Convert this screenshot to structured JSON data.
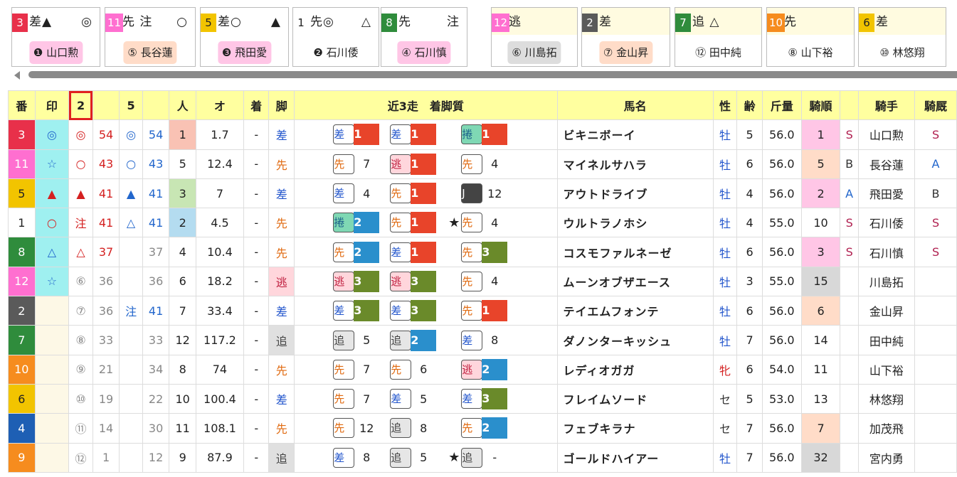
{
  "cards": [
    {
      "num": "3",
      "num_bg": "#e8304a",
      "style": "差▲",
      "mark_r": "◎",
      "jockey": "❶ 山口勲",
      "jockey_bg": "#ffc6e6"
    },
    {
      "num": "11",
      "num_bg": "#ff6fd0",
      "style": "先 注",
      "mark_r": "○",
      "jockey": "⑤ 長谷蓮",
      "jockey_bg": "#ffdcc8"
    },
    {
      "num": "5",
      "num_bg": "#f2c400",
      "style": "差○",
      "mark_r": "▲",
      "jockey": "❸ 飛田愛",
      "jockey_bg": "#ffc6e6"
    },
    {
      "num": "1",
      "num_bg": "#ffffff",
      "style": "先◎",
      "mark_r": "△",
      "jockey": "❷ 石川倭",
      "jockey_bg": "#ffffff"
    },
    {
      "num": "8",
      "num_bg": "#2f8c3c",
      "style": "先",
      "mark_r": "注",
      "jockey": "④ 石川慎",
      "jockey_bg": "#ffc6e6"
    },
    {
      "num": "12",
      "num_bg": "#ff6fd0",
      "style": "逃",
      "mark_r": "",
      "jockey": "⑥ 川島拓",
      "jockey_bg": "#dddddd"
    },
    {
      "num": "2",
      "num_bg": "#5a5a5a",
      "style": "差",
      "mark_r": "",
      "jockey": "⑦ 金山昇",
      "jockey_bg": "#ffdcc8"
    },
    {
      "num": "7",
      "num_bg": "#2f8c3c",
      "style": "追 △",
      "mark_r": "",
      "jockey": "⑫ 田中純",
      "jockey_bg": "#ffffff"
    },
    {
      "num": "10",
      "num_bg": "#f68c1e",
      "style": "先",
      "mark_r": "",
      "jockey": "⑧ 山下裕",
      "jockey_bg": "#ffffff"
    },
    {
      "num": "6",
      "num_bg": "#f2c400",
      "style": "差",
      "mark_r": "",
      "jockey": "⑩ 林悠翔",
      "jockey_bg": "#ffffff"
    }
  ],
  "headers": {
    "ban": "番",
    "shirushi": "印",
    "c2": "2",
    "c5": "5",
    "ninki": "人",
    "odds": "オ",
    "chaku": "着",
    "kyaku": "脚",
    "kinsou": "近3走　着脚質",
    "name": "馬名",
    "sex": "性",
    "age": "齢",
    "weight": "斤量",
    "kijun": "騎順",
    "jockey": "騎手",
    "kihi": "騎厩"
  },
  "colors": {
    "sa": "#2255cc",
    "sen": "#e06a10",
    "nige": "#c02040",
    "oi": "#444444",
    "makuri": "#1a5f8a",
    "r1": "#e8442a",
    "r2": "#2a8fcc",
    "r3": "#6a8a2a",
    "rJ": "#444444"
  },
  "rows": [
    {
      "num": "3",
      "num_bg": "#e8304a",
      "mark": "◎",
      "mark_bg": "#9ff0f0",
      "m2": "◎",
      "m2c": "#d42020",
      "s2": "54",
      "m5": "◎",
      "m5c": "#2266cc",
      "s5": "54",
      "ninki": "1",
      "ninki_bg": "#f9c2b4",
      "odds": "1.7",
      "chaku": "-",
      "kyaku": "差",
      "kyaku_bg": "",
      "kinsou": [
        {
          "t": "差",
          "r": "1"
        },
        {
          "t": "差",
          "r": "1"
        },
        {
          "t": "捲",
          "r": "1"
        }
      ],
      "star": "",
      "name": "ビキニボーイ",
      "sex": "牡",
      "sexc": "#2255cc",
      "age": "5",
      "weight": "56.0",
      "kijun": "1",
      "kijun_bg": "#ffc6e6",
      "rank": "S",
      "rankc": "#b02050",
      "jockey": "山口勲",
      "kihi": "S",
      "kihic": "#b02050"
    },
    {
      "num": "11",
      "num_bg": "#ff6fd0",
      "mark": "☆",
      "mark_bg": "#9ff0f0",
      "m2": "○",
      "m2c": "#d42020",
      "s2": "43",
      "m5": "○",
      "m5c": "#2266cc",
      "s5": "43",
      "ninki": "5",
      "ninki_bg": "",
      "odds": "12.4",
      "chaku": "-",
      "kyaku": "先",
      "kyaku_bg": "",
      "kinsou": [
        {
          "t": "先",
          "r": "7"
        },
        {
          "t": "逃",
          "r": "1"
        },
        {
          "t": "先",
          "r": "4"
        }
      ],
      "star": "",
      "name": "マイネルサハラ",
      "sex": "牡",
      "sexc": "#2255cc",
      "age": "6",
      "weight": "56.0",
      "kijun": "5",
      "kijun_bg": "#ffdcc8",
      "rank": "B",
      "rankc": "#333333",
      "jockey": "長谷蓮",
      "kihi": "A",
      "kihic": "#2266cc"
    },
    {
      "num": "5",
      "num_bg": "#f2c400",
      "mark": "▲",
      "mark_bg": "#9ff0f0",
      "m2": "▲",
      "m2c": "#d42020",
      "s2": "41",
      "m5": "▲",
      "m5c": "#2266cc",
      "s5": "41",
      "ninki": "3",
      "ninki_bg": "#c8e6b4",
      "odds": "7",
      "chaku": "-",
      "kyaku": "差",
      "kyaku_bg": "",
      "kinsou": [
        {
          "t": "差",
          "r": "4"
        },
        {
          "t": "先",
          "r": "1"
        },
        {
          "t": "J",
          "r": "12"
        }
      ],
      "star": "",
      "name": "アウトドライブ",
      "sex": "牡",
      "sexc": "#2255cc",
      "age": "4",
      "weight": "56.0",
      "kijun": "2",
      "kijun_bg": "#ffc6e6",
      "rank": "A",
      "rankc": "#2266cc",
      "jockey": "飛田愛",
      "kihi": "B",
      "kihic": "#333333"
    },
    {
      "num": "1",
      "num_bg": "#ffffff",
      "mark": "○",
      "mark_bg": "#9ff0f0",
      "m2": "注",
      "m2c": "#d42020",
      "s2": "41",
      "m5": "△",
      "m5c": "#2266cc",
      "s5": "41",
      "ninki": "2",
      "ninki_bg": "#b4dcf0",
      "odds": "4.5",
      "chaku": "-",
      "kyaku": "先",
      "kyaku_bg": "",
      "kinsou": [
        {
          "t": "捲",
          "r": "2"
        },
        {
          "t": "先",
          "r": "1"
        },
        {
          "t": "先",
          "r": "4"
        }
      ],
      "star": "★",
      "name": "ウルトラノホシ",
      "sex": "牡",
      "sexc": "#2255cc",
      "age": "4",
      "weight": "55.0",
      "kijun": "10",
      "kijun_bg": "",
      "rank": "S",
      "rankc": "#b02050",
      "jockey": "石川倭",
      "kihi": "S",
      "kihic": "#b02050"
    },
    {
      "num": "8",
      "num_bg": "#2f8c3c",
      "mark": "△",
      "mark_bg": "#9ff0f0",
      "m2": "△",
      "m2c": "#d42020",
      "s2": "37",
      "m5": "",
      "m5c": "#2266cc",
      "s5": "37",
      "ninki": "4",
      "ninki_bg": "",
      "odds": "10.4",
      "chaku": "-",
      "kyaku": "先",
      "kyaku_bg": "",
      "kinsou": [
        {
          "t": "先",
          "r": "2"
        },
        {
          "t": "差",
          "r": "1"
        },
        {
          "t": "先",
          "r": "3"
        }
      ],
      "star": "",
      "name": "コスモファルネーゼ",
      "sex": "牡",
      "sexc": "#2255cc",
      "age": "6",
      "weight": "56.0",
      "kijun": "3",
      "kijun_bg": "#ffc6e6",
      "rank": "S",
      "rankc": "#b02050",
      "jockey": "石川慎",
      "kihi": "S",
      "kihic": "#b02050"
    },
    {
      "num": "12",
      "num_bg": "#ff6fd0",
      "mark": "☆",
      "mark_bg": "#9ff0f0",
      "m2": "⑥",
      "m2c": "#888888",
      "s2": "36",
      "m5": "",
      "m5c": "#2266cc",
      "s5": "36",
      "ninki": "6",
      "ninki_bg": "",
      "odds": "18.2",
      "chaku": "-",
      "kyaku": "逃",
      "kyaku_bg": "#ffd6dc",
      "kinsou": [
        {
          "t": "逃",
          "r": "3"
        },
        {
          "t": "逃",
          "r": "3"
        },
        {
          "t": "先",
          "r": "4"
        }
      ],
      "star": "",
      "name": "ムーンオブザエース",
      "sex": "牡",
      "sexc": "#2255cc",
      "age": "3",
      "weight": "55.0",
      "kijun": "15",
      "kijun_bg": "#d8d8d8",
      "rank": "",
      "rankc": "#333333",
      "jockey": "川島拓",
      "kihi": "",
      "kihic": "#333333"
    },
    {
      "num": "2",
      "num_bg": "#5a5a5a",
      "mark": "",
      "mark_bg": "#fdf8e6",
      "m2": "⑦",
      "m2c": "#888888",
      "s2": "36",
      "m5": "注",
      "m5c": "#2266cc",
      "s5": "41",
      "ninki": "7",
      "ninki_bg": "",
      "odds": "33.4",
      "chaku": "-",
      "kyaku": "差",
      "kyaku_bg": "",
      "kinsou": [
        {
          "t": "差",
          "r": "3"
        },
        {
          "t": "差",
          "r": "3"
        },
        {
          "t": "先",
          "r": "1"
        }
      ],
      "star": "",
      "name": "テイエムフォンテ",
      "sex": "牡",
      "sexc": "#2255cc",
      "age": "6",
      "weight": "56.0",
      "kijun": "6",
      "kijun_bg": "#ffdcc8",
      "rank": "",
      "rankc": "#333333",
      "jockey": "金山昇",
      "kihi": "",
      "kihic": "#333333"
    },
    {
      "num": "7",
      "num_bg": "#2f8c3c",
      "mark": "",
      "mark_bg": "#fdf8e6",
      "m2": "⑧",
      "m2c": "#888888",
      "s2": "33",
      "m5": "",
      "m5c": "#2266cc",
      "s5": "33",
      "ninki": "12",
      "ninki_bg": "",
      "odds": "117.2",
      "chaku": "-",
      "kyaku": "追",
      "kyaku_bg": "#e0e0e0",
      "kinsou": [
        {
          "t": "追",
          "r": "5"
        },
        {
          "t": "追",
          "r": "2"
        },
        {
          "t": "差",
          "r": "8"
        }
      ],
      "star": "",
      "name": "ダノンターキッシュ",
      "sex": "牡",
      "sexc": "#2255cc",
      "age": "7",
      "weight": "56.0",
      "kijun": "14",
      "kijun_bg": "",
      "rank": "",
      "rankc": "#333333",
      "jockey": "田中純",
      "kihi": "",
      "kihic": "#333333"
    },
    {
      "num": "10",
      "num_bg": "#f68c1e",
      "mark": "",
      "mark_bg": "#fdf8e6",
      "m2": "⑨",
      "m2c": "#888888",
      "s2": "21",
      "m5": "",
      "m5c": "#2266cc",
      "s5": "34",
      "ninki": "8",
      "ninki_bg": "",
      "odds": "74",
      "chaku": "-",
      "kyaku": "先",
      "kyaku_bg": "",
      "kinsou": [
        {
          "t": "先",
          "r": "7"
        },
        {
          "t": "先",
          "r": "6"
        },
        {
          "t": "逃",
          "r": "2"
        }
      ],
      "star": "",
      "name": "レディオガガ",
      "sex": "牝",
      "sexc": "#d42020",
      "age": "6",
      "weight": "54.0",
      "kijun": "11",
      "kijun_bg": "",
      "rank": "",
      "rankc": "#333333",
      "jockey": "山下裕",
      "kihi": "",
      "kihic": "#333333"
    },
    {
      "num": "6",
      "num_bg": "#f2c400",
      "mark": "",
      "mark_bg": "#fdf8e6",
      "m2": "⑩",
      "m2c": "#888888",
      "s2": "19",
      "m5": "",
      "m5c": "#2266cc",
      "s5": "22",
      "ninki": "10",
      "ninki_bg": "",
      "odds": "100.4",
      "chaku": "-",
      "kyaku": "差",
      "kyaku_bg": "",
      "kinsou": [
        {
          "t": "先",
          "r": "7"
        },
        {
          "t": "差",
          "r": "5"
        },
        {
          "t": "差",
          "r": "3"
        }
      ],
      "star": "",
      "name": "フレイムソード",
      "sex": "セ",
      "sexc": "#333333",
      "age": "5",
      "weight": "53.0",
      "kijun": "13",
      "kijun_bg": "",
      "rank": "",
      "rankc": "#333333",
      "jockey": "林悠翔",
      "kihi": "",
      "kihic": "#333333"
    },
    {
      "num": "4",
      "num_bg": "#1e5fb4",
      "mark": "",
      "mark_bg": "#fdf8e6",
      "m2": "⑪",
      "m2c": "#888888",
      "s2": "14",
      "m5": "",
      "m5c": "#2266cc",
      "s5": "30",
      "ninki": "11",
      "ninki_bg": "",
      "odds": "108.1",
      "chaku": "-",
      "kyaku": "先",
      "kyaku_bg": "",
      "kinsou": [
        {
          "t": "先",
          "r": "12"
        },
        {
          "t": "追",
          "r": "8"
        },
        {
          "t": "先",
          "r": "2"
        }
      ],
      "star": "",
      "name": "フェブキラナ",
      "sex": "セ",
      "sexc": "#333333",
      "age": "7",
      "weight": "56.0",
      "kijun": "7",
      "kijun_bg": "#ffdcc8",
      "rank": "",
      "rankc": "#333333",
      "jockey": "加茂飛",
      "kihi": "",
      "kihic": "#333333"
    },
    {
      "num": "9",
      "num_bg": "#f68c1e",
      "mark": "",
      "mark_bg": "#fdf8e6",
      "m2": "⑫",
      "m2c": "#888888",
      "s2": "1",
      "m5": "",
      "m5c": "#2266cc",
      "s5": "12",
      "ninki": "9",
      "ninki_bg": "",
      "odds": "87.9",
      "chaku": "-",
      "kyaku": "追",
      "kyaku_bg": "#e0e0e0",
      "kinsou": [
        {
          "t": "差",
          "r": "8"
        },
        {
          "t": "追",
          "r": "5"
        },
        {
          "t": "追",
          "r": "-"
        }
      ],
      "star": "★",
      "name": "ゴールドハイアー",
      "sex": "牡",
      "sexc": "#2255cc",
      "age": "7",
      "weight": "56.0",
      "kijun": "32",
      "kijun_bg": "#d8d8d8",
      "rank": "",
      "rankc": "#333333",
      "jockey": "宮内勇",
      "kihi": "",
      "kihic": "#333333"
    }
  ]
}
